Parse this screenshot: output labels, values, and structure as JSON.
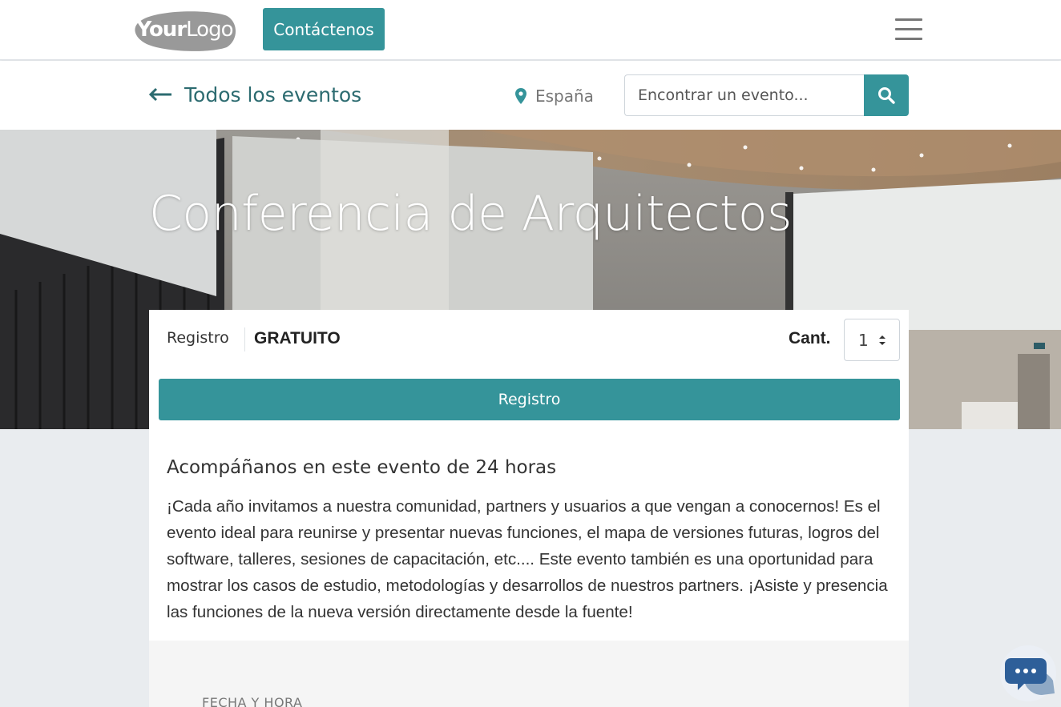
{
  "header": {
    "logo_text_bold": "Your",
    "logo_text_light": "Logo",
    "contact_label": "Contáctenos"
  },
  "subnav": {
    "back_label": "Todos los eventos",
    "location": "España",
    "search_placeholder": "Encontrar un evento..."
  },
  "hero": {
    "title": "Conferencia de Arquitectos"
  },
  "registration": {
    "label": "Registro",
    "price": "GRATUITO",
    "qty_label": "Cant.",
    "qty_value": "1",
    "button_label": "Registro"
  },
  "description": {
    "heading": "Acompáñanos en este evento de 24 horas",
    "body": "¡Cada año invitamos a nuestra comunidad, partners y usuarios a que vengan a conocernos! Es el evento ideal para reunirse y presentar nuevas funciones, el mapa de versiones futuras, logros del software, talleres, sesiones de capacitación, etc.... Este evento también es una oportunidad para mostrar los casos de estudio, metodologías y desarrollos de nuestros partners. ¡Asiste y presencia las funciones de la nueva versión directamente desde la fuente!"
  },
  "details": {
    "date_label": "FECHA Y HORA"
  },
  "colors": {
    "accent": "#35949a",
    "link": "#2c6b70",
    "page_bg": "#e9ecef"
  },
  "icons": {
    "back": "arrow-left-icon",
    "location": "map-pin-icon",
    "search": "search-icon",
    "menu": "hamburger-menu-icon",
    "qty": "sort-caret-icon",
    "chat": "chat-bubble-icon"
  }
}
